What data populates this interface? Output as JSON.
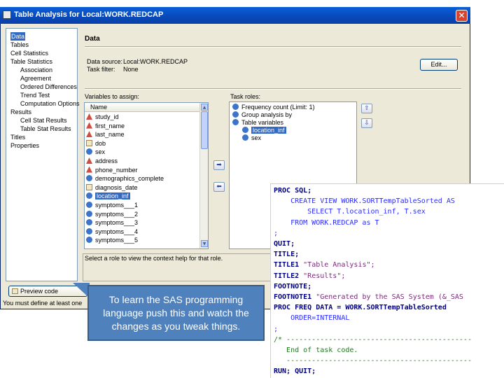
{
  "window": {
    "title": "Table Analysis for Local:WORK.REDCAP",
    "close_glyph": "✕"
  },
  "nav": {
    "items": [
      {
        "label": "Data",
        "indent": 0,
        "selected": true
      },
      {
        "label": "Tables",
        "indent": 0
      },
      {
        "label": "Cell Statistics",
        "indent": 0
      },
      {
        "label": "Table Statistics",
        "indent": 0
      },
      {
        "label": "Association",
        "indent": 1
      },
      {
        "label": "Agreement",
        "indent": 1
      },
      {
        "label": "Ordered Differences",
        "indent": 1
      },
      {
        "label": "Trend Test",
        "indent": 1
      },
      {
        "label": "Computation Options",
        "indent": 1
      },
      {
        "label": "Results",
        "indent": 0
      },
      {
        "label": "Cell Stat Results",
        "indent": 1
      },
      {
        "label": "Table Stat Results",
        "indent": 1
      },
      {
        "label": "Titles",
        "indent": 0
      },
      {
        "label": "Properties",
        "indent": 0
      }
    ]
  },
  "main": {
    "header": "Data",
    "data_source_label": "Data source:",
    "data_source_value": "Local:WORK.REDCAP",
    "task_filter_label": "Task filter:",
    "task_filter_value": "None",
    "edit_button": "Edit...",
    "variables_label": "Variables to assign:",
    "name_column": "Name",
    "variables": [
      {
        "name": "study_id",
        "icon": "char"
      },
      {
        "name": "first_name",
        "icon": "char"
      },
      {
        "name": "last_name",
        "icon": "char"
      },
      {
        "name": "dob",
        "icon": "date"
      },
      {
        "name": "sex",
        "icon": "num"
      },
      {
        "name": "address",
        "icon": "char"
      },
      {
        "name": "phone_number",
        "icon": "char"
      },
      {
        "name": "demographics_complete",
        "icon": "num"
      },
      {
        "name": "diagnosis_date",
        "icon": "date"
      },
      {
        "name": "location_inf",
        "icon": "num",
        "selected": true
      },
      {
        "name": "symptoms___1",
        "icon": "num"
      },
      {
        "name": "symptoms___2",
        "icon": "num"
      },
      {
        "name": "symptoms___3",
        "icon": "num"
      },
      {
        "name": "symptoms___4",
        "icon": "num"
      },
      {
        "name": "symptoms___5",
        "icon": "num"
      }
    ],
    "task_roles_label": "Task roles:",
    "task_roles": [
      {
        "label": "Frequency count (Limit: 1)",
        "indent": 0
      },
      {
        "label": "Group analysis by",
        "indent": 0
      },
      {
        "label": "Table variables",
        "indent": 0
      },
      {
        "label": "location_inf",
        "indent": 1,
        "selected": true
      },
      {
        "label": "sex",
        "indent": 1
      }
    ],
    "help_text": "Select a role to view the context help for that role.",
    "preview_button": "Preview code",
    "status_text": "You must define at least one"
  },
  "code": {
    "lines": [
      [
        {
          "t": "PROC SQL;",
          "c": "kw"
        }
      ],
      [
        {
          "t": "    CREATE VIEW WORK.SORTTempTableSorted AS",
          "c": "op"
        }
      ],
      [
        {
          "t": "        SELECT T.location_inf, T.sex",
          "c": "op"
        }
      ],
      [
        {
          "t": "    FROM WORK.REDCAP as T",
          "c": "op"
        }
      ],
      [
        {
          "t": ";",
          "c": "op"
        }
      ],
      [
        {
          "t": "QUIT;",
          "c": "kw"
        }
      ],
      [
        {
          "t": "TITLE;",
          "c": "kw"
        }
      ],
      [
        {
          "t": "TITLE1 ",
          "c": "kw"
        },
        {
          "t": "\"Table Analysis\";",
          "c": "str"
        }
      ],
      [
        {
          "t": "TITLE2 ",
          "c": "kw"
        },
        {
          "t": "\"Results\";",
          "c": "str"
        }
      ],
      [
        {
          "t": "FOOTNOTE;",
          "c": "kw"
        }
      ],
      [
        {
          "t": "FOOTNOTE1 ",
          "c": "kw"
        },
        {
          "t": "\"Generated by the SAS System (&_SAS",
          "c": "str"
        }
      ],
      [
        {
          "t": "PROC FREQ DATA = WORK.SORTTempTableSorted",
          "c": "kw"
        }
      ],
      [
        {
          "t": "    ORDER=INTERNAL",
          "c": "op"
        }
      ],
      [
        {
          "t": ";",
          "c": "op"
        }
      ],
      [
        {
          "t": "/* --------------------------------------------",
          "c": "cmt"
        }
      ],
      [
        {
          "t": "   End of task code.",
          "c": "cmt"
        }
      ],
      [
        {
          "t": "   --------------------------------------------",
          "c": "cmt"
        }
      ],
      [
        {
          "t": "RUN; QUIT;",
          "c": "kw"
        }
      ]
    ]
  },
  "callout": {
    "text": "To learn the SAS programming language push this and watch the changes as you tweak things."
  },
  "colors": {
    "titlebar": "#0a5fd8",
    "selection": "#316ac5",
    "callout": "#4f81bd",
    "sas_keyword": "#000080",
    "sas_comment": "#1f7a1f",
    "sas_string": "#7a2a7a"
  }
}
